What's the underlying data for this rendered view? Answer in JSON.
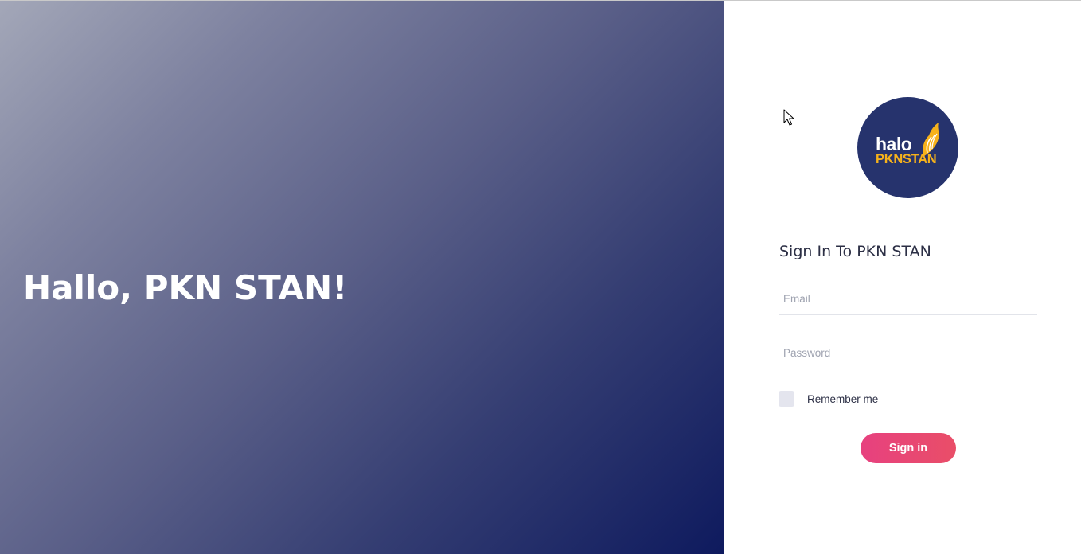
{
  "hero": {
    "title": "Hallo, PKN STAN!"
  },
  "logo": {
    "line1": "halo",
    "line2": "PKNSTAN",
    "colors": {
      "background": "#26336d",
      "accent": "#f6b21b"
    }
  },
  "login": {
    "heading": "Sign In To PKN STAN",
    "email_placeholder": "Email",
    "password_placeholder": "Password",
    "remember_label": "Remember me",
    "remember_checked": false,
    "submit_label": "Sign in"
  },
  "colors": {
    "button": "#e7417f",
    "gradient_start": "#a3a7b8",
    "gradient_end": "#0e1a5e"
  },
  "icons": {
    "cursor": "mouse-pointer-icon",
    "logo_wing": "wing-icon"
  }
}
